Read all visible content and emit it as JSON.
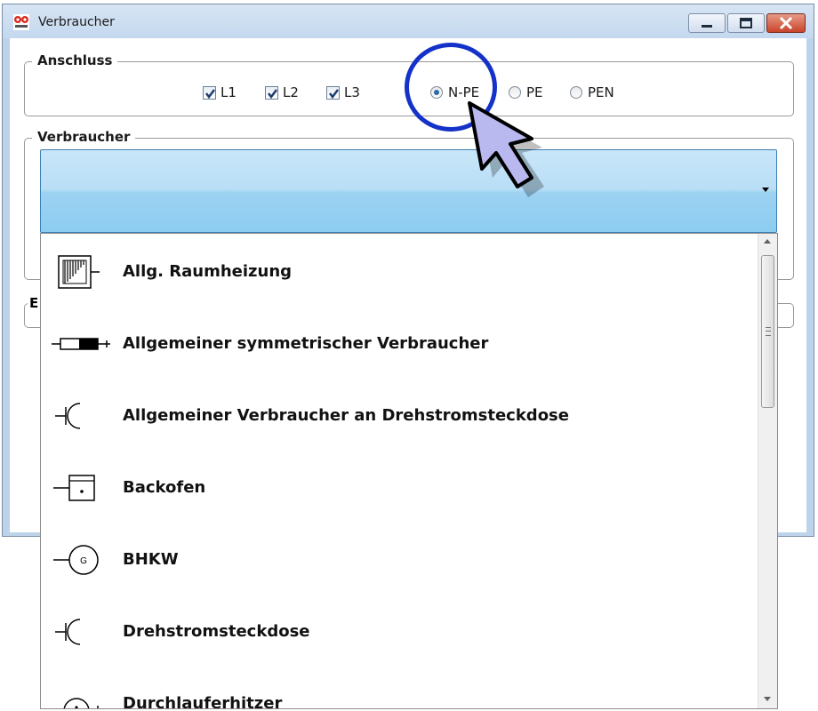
{
  "window": {
    "title": "Verbraucher",
    "app_icon": "op-logo-icon",
    "controls": [
      "minimize-icon",
      "maximize-icon",
      "close-icon"
    ]
  },
  "anschluss": {
    "legend": "Anschluss",
    "checkboxes": [
      {
        "label": "L1",
        "checked": true
      },
      {
        "label": "L2",
        "checked": true
      },
      {
        "label": "L3",
        "checked": true
      }
    ],
    "radios": [
      {
        "label": "N-PE",
        "selected": true
      },
      {
        "label": "PE",
        "selected": false
      },
      {
        "label": "PEN",
        "selected": false
      }
    ]
  },
  "verbraucher": {
    "legend": "Verbraucher",
    "combo_value": ""
  },
  "partial_group": {
    "letter": "E"
  },
  "dropdown": {
    "items": [
      {
        "label": "Allg. Raumheizung",
        "icon": "room-heating-icon"
      },
      {
        "label": "Allgemeiner symmetrischer Verbraucher",
        "icon": "symmetric-consumer-icon"
      },
      {
        "label": "Allgemeiner Verbraucher an Drehstromsteckdose",
        "icon": "three-phase-socket-icon"
      },
      {
        "label": "Backofen",
        "icon": "oven-icon"
      },
      {
        "label": "BHKW",
        "icon": "chp-generator-icon",
        "icon_text": "G"
      },
      {
        "label": "Drehstromsteckdose",
        "icon": "three-phase-socket-icon"
      },
      {
        "label": "Durchlauferhitzer",
        "icon": "instant-water-heater-icon"
      }
    ]
  },
  "colors": {
    "highlight": "#1432c8",
    "cursor_fill": "#b9b9f0",
    "combo_selected": "#9dd2f2"
  }
}
